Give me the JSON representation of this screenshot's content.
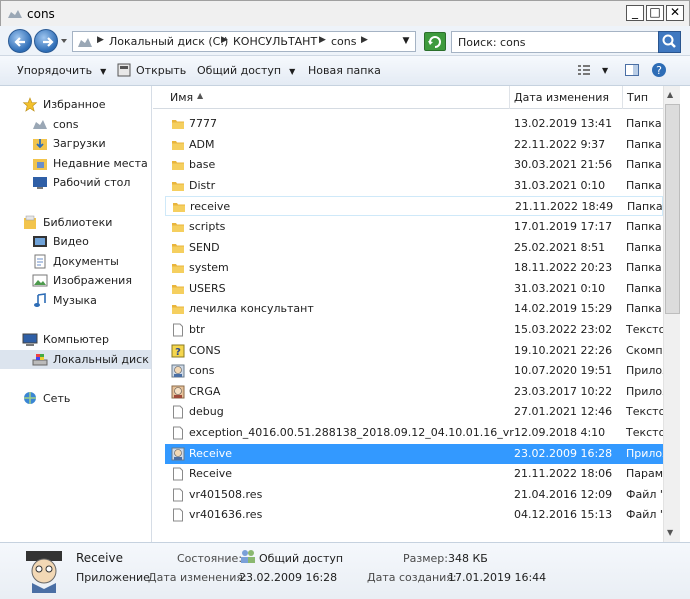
{
  "window": {
    "title": "cons",
    "controls": {
      "minimize": "_",
      "maximize": "□",
      "close": "✕"
    }
  },
  "address": {
    "crumbs": [
      "Локальный диск (C:)",
      "КОНСУЛЬТАНТ",
      "cons"
    ],
    "search_placeholder": "Поиск: cons"
  },
  "toolbar": {
    "organize": "Упорядочить",
    "open": "Открыть",
    "share": "Общий доступ",
    "new_folder": "Новая папка"
  },
  "nav": {
    "favorites": "Избранное",
    "fav_items": [
      "cons",
      "Загрузки",
      "Недавние места",
      "Рабочий стол"
    ],
    "libraries": "Библиотеки",
    "lib_items": [
      "Видео",
      "Документы",
      "Изображения",
      "Музыка"
    ],
    "computer": "Компьютер",
    "comp_items": [
      "Локальный диск (C"
    ],
    "network": "Сеть"
  },
  "columns": {
    "name": "Имя",
    "date": "Дата изменения",
    "type": "Тип"
  },
  "files": [
    {
      "name": "7777",
      "date": "13.02.2019 13:41",
      "type": "Папка с",
      "icon": "folder"
    },
    {
      "name": "ADM",
      "date": "22.11.2022 9:37",
      "type": "Папка с",
      "icon": "folder"
    },
    {
      "name": "base",
      "date": "30.03.2021 21:56",
      "type": "Папка с",
      "icon": "folder"
    },
    {
      "name": "Distr",
      "date": "31.03.2021 0:10",
      "type": "Папка с",
      "icon": "folder"
    },
    {
      "name": "receive",
      "date": "21.11.2022 18:49",
      "type": "Папка с",
      "icon": "folder"
    },
    {
      "name": "scripts",
      "date": "17.01.2019 17:17",
      "type": "Папка с",
      "icon": "folder"
    },
    {
      "name": "SEND",
      "date": "25.02.2021 8:51",
      "type": "Папка с",
      "icon": "folder"
    },
    {
      "name": "system",
      "date": "18.11.2022 20:23",
      "type": "Папка с",
      "icon": "folder"
    },
    {
      "name": "USERS",
      "date": "31.03.2021 0:10",
      "type": "Папка с",
      "icon": "folder"
    },
    {
      "name": "лечилка консультант",
      "date": "14.02.2019 15:29",
      "type": "Папка с",
      "icon": "folder"
    },
    {
      "name": "btr",
      "date": "15.03.2022 23:02",
      "type": "Текстов",
      "icon": "file"
    },
    {
      "name": "CONS",
      "date": "19.10.2021 22:26",
      "type": "Скомпи",
      "icon": "help"
    },
    {
      "name": "cons",
      "date": "10.07.2020 19:51",
      "type": "Прилож",
      "icon": "app"
    },
    {
      "name": "CRGA",
      "date": "23.03.2017 10:22",
      "type": "Прилож",
      "icon": "app2"
    },
    {
      "name": "debug",
      "date": "27.01.2021 12:46",
      "type": "Текстов",
      "icon": "file"
    },
    {
      "name": "exception_4016.00.51.288138_2018.09.12_04.10.01.16_vr",
      "date": "12.09.2018 4:10",
      "type": "Текстов",
      "icon": "file"
    },
    {
      "name": "Receive",
      "date": "23.02.2009 16:28",
      "type": "Прилож",
      "icon": "app"
    },
    {
      "name": "Receive",
      "date": "21.11.2022 18:06",
      "type": "Параме",
      "icon": "file"
    },
    {
      "name": "vr401508.res",
      "date": "21.04.2016 12:09",
      "type": "Файл \"F",
      "icon": "file"
    },
    {
      "name": "vr401636.res",
      "date": "04.12.2016 15:13",
      "type": "Файл \"F",
      "icon": "file"
    }
  ],
  "details": {
    "name": "Receive",
    "kind": "Приложение",
    "state_label": "Состояние:",
    "state_value": "Общий доступ",
    "modified_label": "Дата изменения:",
    "modified_value": "23.02.2009 16:28",
    "size_label": "Размер:",
    "size_value": "348 КБ",
    "created_label": "Дата создания:",
    "created_value": "17.01.2019 16:44"
  },
  "colors": {
    "selection": "#3399ff",
    "folder": "#f2c44c",
    "accent": "#2e6db6"
  }
}
